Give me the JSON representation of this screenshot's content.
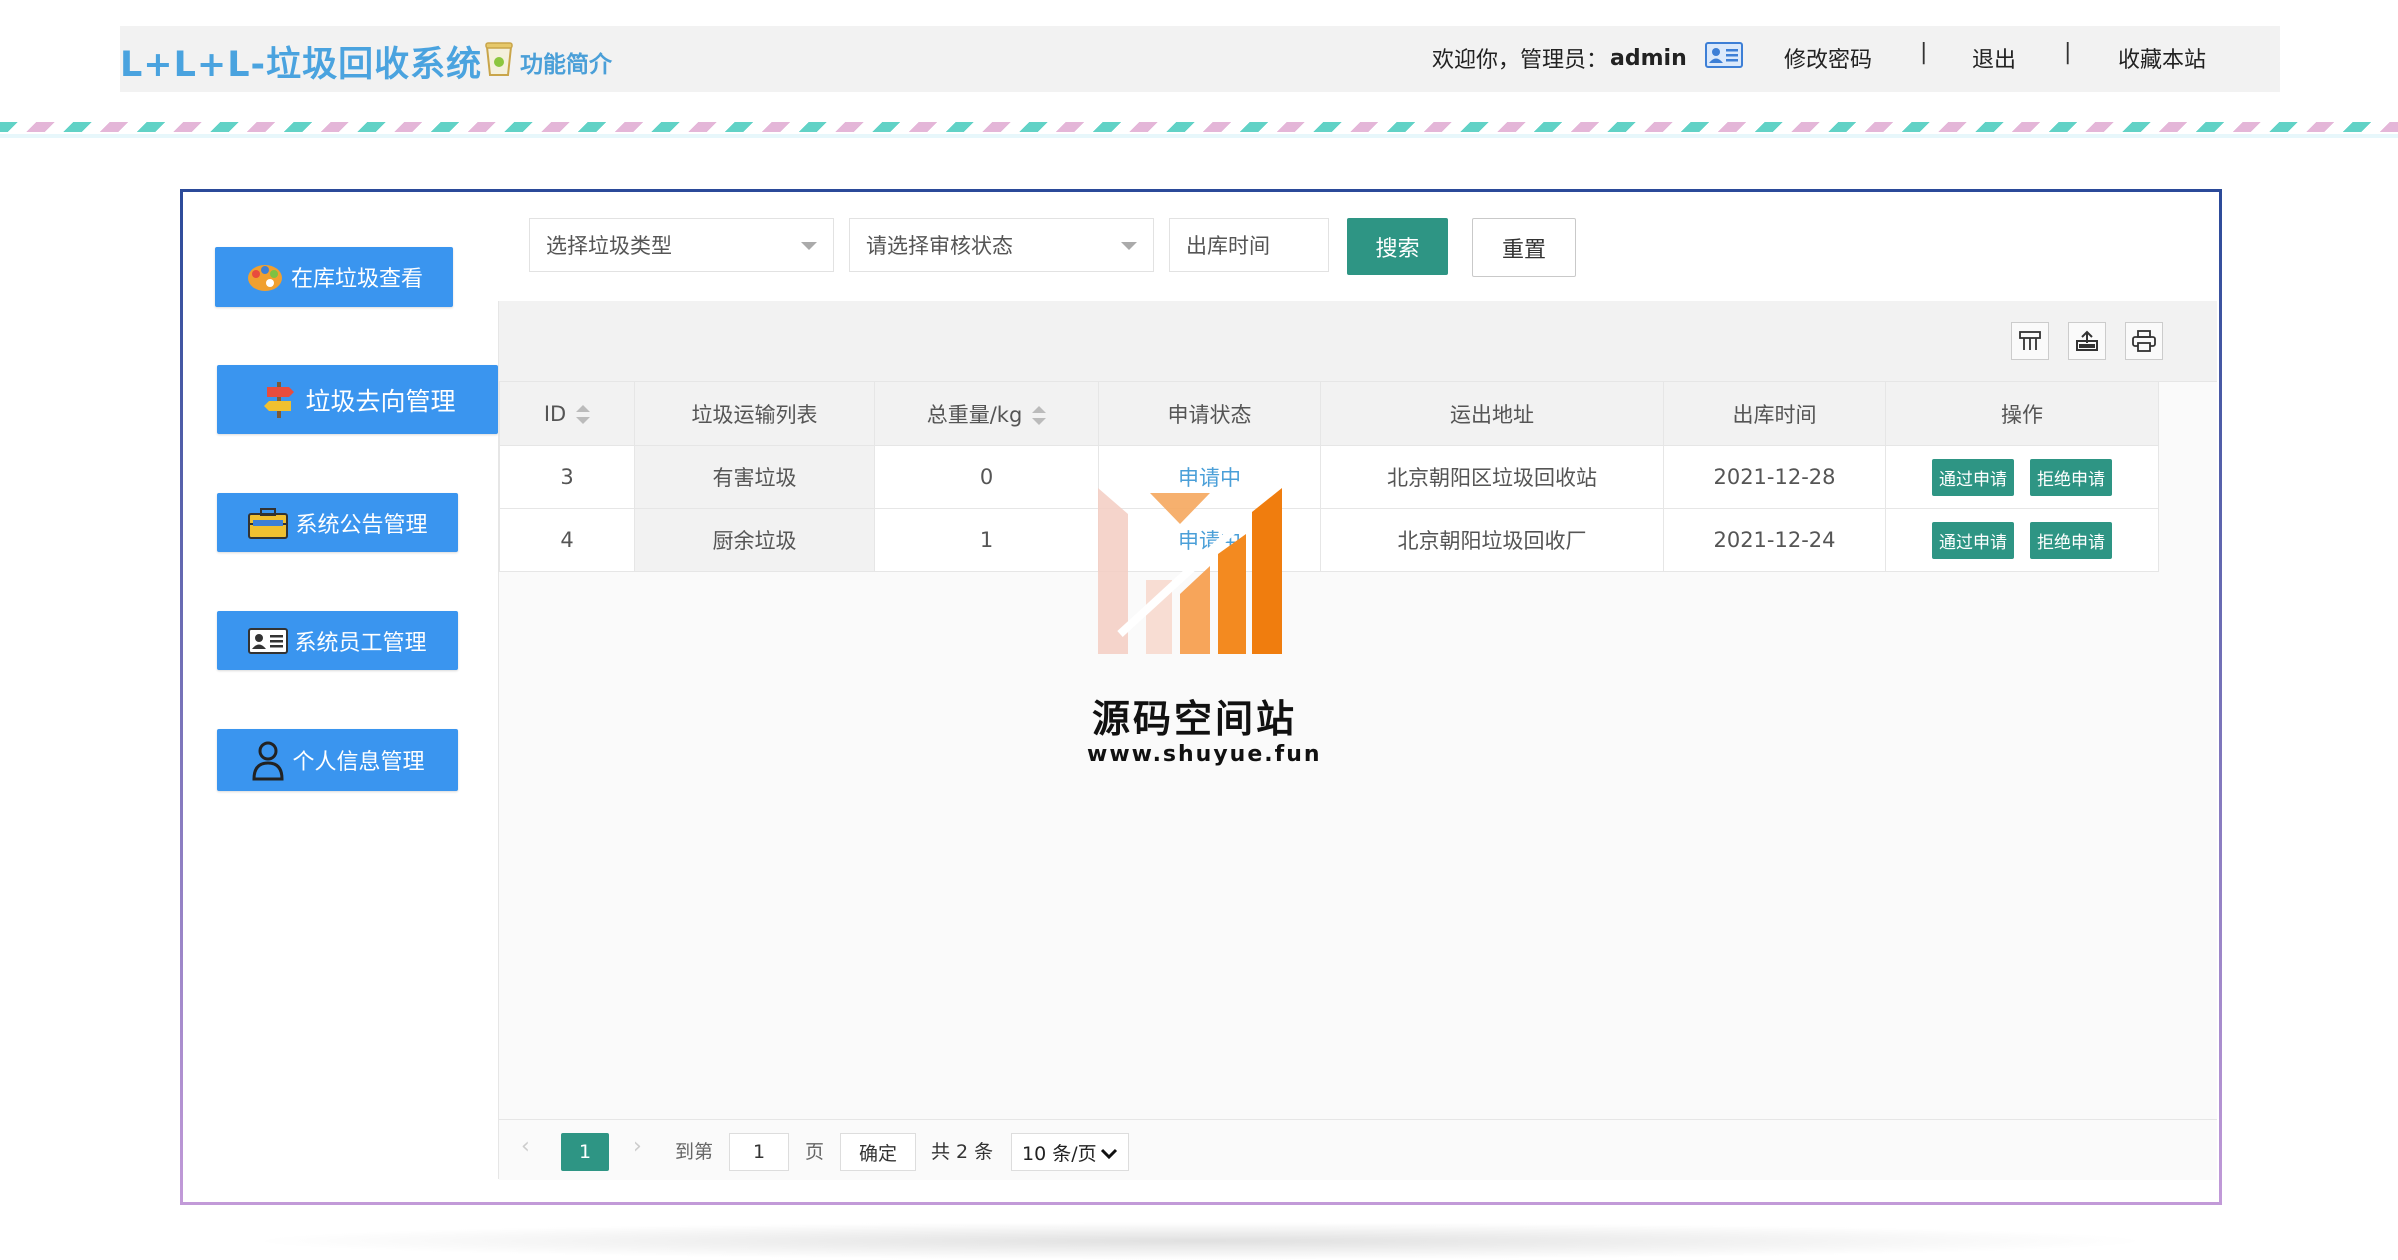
{
  "header": {
    "logo": "L+L+L-垃圾回收系统",
    "intro_link": "功能简介",
    "welcome_prefix": "欢迎你，管理员：",
    "username": "admin",
    "links": [
      "修改密码",
      "退出",
      "收藏本站"
    ],
    "separator": "|"
  },
  "sidebar": {
    "items": [
      {
        "label": "在库垃圾查看",
        "icon": "palette-icon"
      },
      {
        "label": "垃圾去向管理",
        "icon": "signpost-icon"
      },
      {
        "label": "系统公告管理",
        "icon": "briefcase-icon"
      },
      {
        "label": "系统员工管理",
        "icon": "id-card-icon"
      },
      {
        "label": "个人信息管理",
        "icon": "user-icon"
      }
    ]
  },
  "filters": {
    "type_select": "选择垃圾类型",
    "status_select": "请选择审核状态",
    "date_placeholder": "出库时间",
    "search_label": "搜索",
    "reset_label": "重置"
  },
  "toolbar": {
    "icons": [
      "columns-icon",
      "export-icon",
      "print-icon"
    ]
  },
  "table": {
    "columns": [
      "ID",
      "垃圾运输列表",
      "总重量/kg",
      "申请状态",
      "运出地址",
      "出库时间",
      "操作"
    ],
    "rows": [
      {
        "id": "3",
        "type": "有害垃圾",
        "weight": "0",
        "status": "申请中",
        "address": "北京朝阳区垃圾回收站",
        "date": "2021-12-28"
      },
      {
        "id": "4",
        "type": "厨余垃圾",
        "weight": "1",
        "status": "申请中",
        "address": "北京朝阳垃圾回收厂",
        "date": "2021-12-24"
      }
    ],
    "approve_label": "通过申请",
    "reject_label": "拒绝申请"
  },
  "pagination": {
    "prev": "‹",
    "current": "1",
    "next": "›",
    "goto_prefix": "到第",
    "goto_value": "1",
    "goto_suffix": "页",
    "confirm": "确定",
    "total": "共 2 条",
    "page_size": "10 条/页"
  },
  "watermark": {
    "title": "源码空间站",
    "url": "www.shuyue.fun"
  },
  "colors": {
    "brand_blue": "#4aa3df",
    "side_button": "#3a95ef",
    "teal": "#2e9584",
    "status_blue": "#4a9fd8"
  }
}
